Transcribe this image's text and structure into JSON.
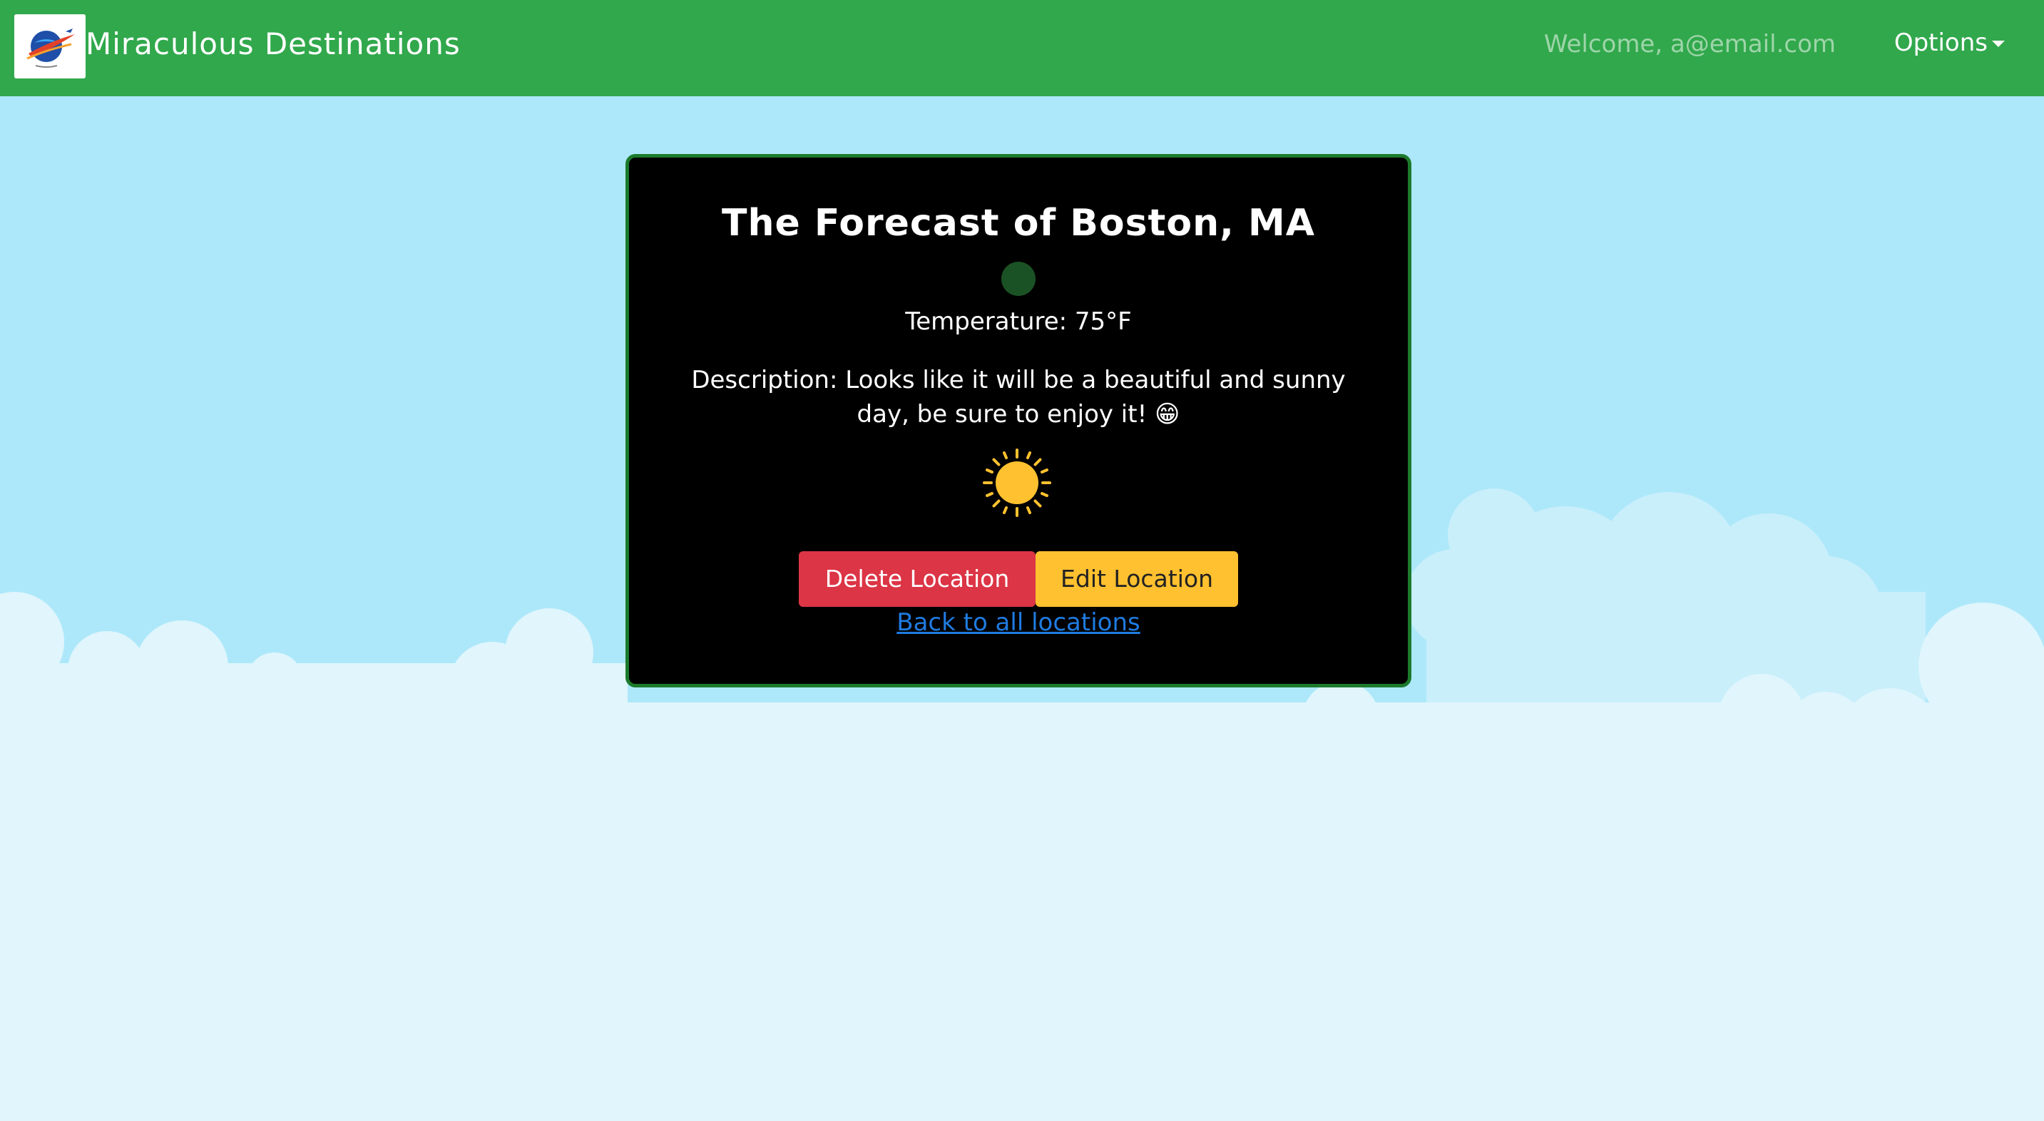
{
  "navbar": {
    "brand_name": "Miraculous Destinations",
    "logo_icon": "globe-airplane-logo",
    "welcome_text": "Welcome, a@email.com",
    "options_label": "Options"
  },
  "card": {
    "title": "The Forecast of Boston, MA",
    "temperature": "Temperature: 75°F",
    "description": "Description: Looks like it will be a beautiful and sunny day, be sure to enjoy it! 😁",
    "weather_icon": "sun-icon",
    "delete_label": "Delete Location",
    "edit_label": "Edit Location",
    "back_label": "Back to all locations"
  },
  "colors": {
    "navbar": "#31A84C",
    "sky": "#ADE8FA",
    "clouds": "#E0F5FC",
    "card_bg": "#000000",
    "card_border": "#1C7A2C",
    "delete": "#DC3545",
    "edit": "#FFC12F",
    "link": "#1F7BE0",
    "sun": "#FFC12F"
  }
}
